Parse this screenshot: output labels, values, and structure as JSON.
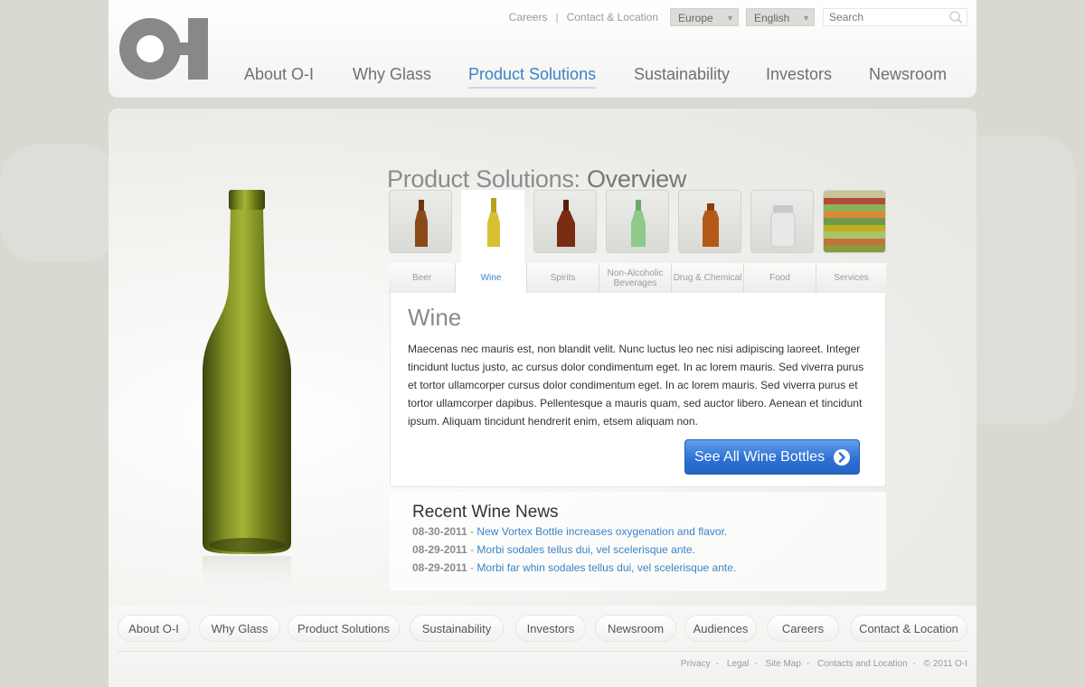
{
  "colors": {
    "accent": "#3a84c6",
    "cta": "#2f72d4",
    "background": "#d9d8d1",
    "logo": "#888888"
  },
  "header": {
    "logo_text": "O-I",
    "utility": {
      "careers": "Careers",
      "contact": "Contact & Location",
      "region": "Europe",
      "language": "English"
    },
    "search": {
      "placeholder": "Search",
      "icon": "search-icon"
    },
    "nav": [
      {
        "label": "About O-I",
        "active": false
      },
      {
        "label": "Why Glass",
        "active": false
      },
      {
        "label": "Product Solutions",
        "active": true
      },
      {
        "label": "Sustainability",
        "active": false
      },
      {
        "label": "Investors",
        "active": false
      },
      {
        "label": "Newsroom",
        "active": false
      }
    ]
  },
  "main": {
    "title_prefix": "Product Solutions:",
    "title_emphasis": "Overview",
    "tabs": [
      {
        "label": "Beer",
        "active": false
      },
      {
        "label": "Wine",
        "active": true
      },
      {
        "label": "Spirits",
        "active": false
      },
      {
        "label": "Non-Alcoholic Beverages",
        "active": false
      },
      {
        "label": "Drug & Chemical",
        "active": false
      },
      {
        "label": "Food",
        "active": false
      },
      {
        "label": "Services",
        "active": false
      }
    ],
    "card": {
      "title": "Wine",
      "body": "Maecenas nec mauris est, non blandit velit. Nunc luctus leo nec nisi adipiscing laoreet. Integer tincidunt luctus justo, ac cursus dolor condimentum eget. In ac lorem mauris. Sed viverra purus et tortor ullamcorper cursus dolor condimentum eget. In ac lorem mauris. Sed viverra purus et tortor ullamcorper dapibus. Pellentesque a mauris quam, sed auctor libero. Aenean et tincidunt ipsum. Aliquam tincidunt hendrerit enim, etsem aliquam non.",
      "cta_label": "See All Wine Bottles"
    },
    "news": {
      "title": "Recent Wine News",
      "items": [
        {
          "date": "08-30-2011",
          "text": "New Vortex Bottle increases oxygenation and flavor."
        },
        {
          "date": "08-29-2011",
          "text": "Morbi sodales tellus dui, vel scelerisque ante."
        },
        {
          "date": "08-29-2011",
          "text": "Morbi far whin sodales tellus dui, vel scelerisque ante."
        }
      ]
    }
  },
  "footer": {
    "nav": [
      "About O-I",
      "Why Glass",
      "Product Solutions",
      "Sustainability",
      "Investors",
      "Newsroom",
      "Audiences",
      "Careers",
      "Contact & Location"
    ],
    "legal": [
      "Privacy",
      "Legal",
      "Site Map",
      "Contacts and Location",
      "© 2011 O-I"
    ]
  }
}
